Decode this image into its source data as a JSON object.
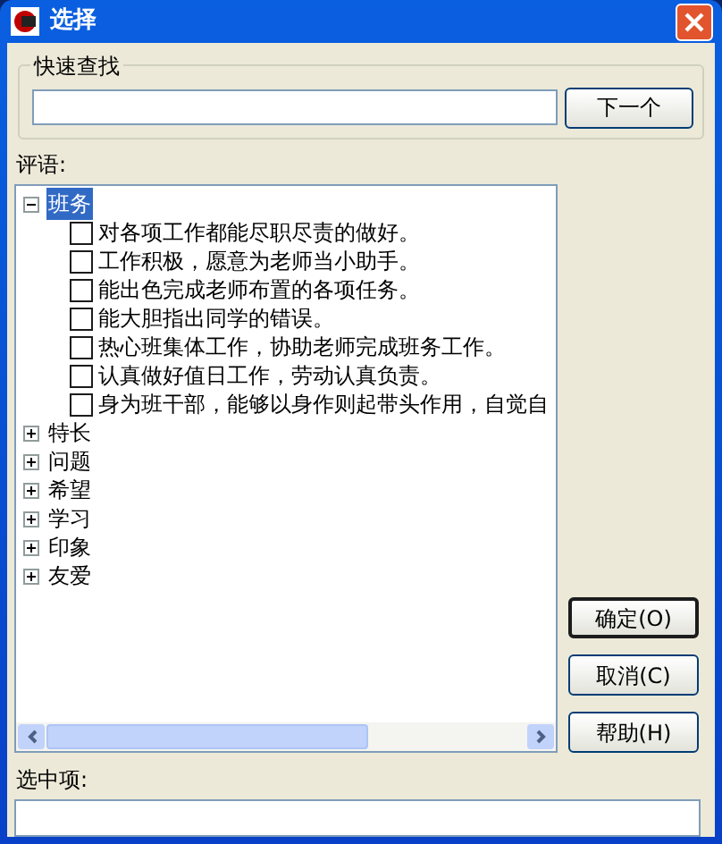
{
  "window": {
    "title": "选择"
  },
  "quick_find": {
    "legend": "快速查找",
    "button": "下一个"
  },
  "comments_label": "评语:",
  "tree": [
    {
      "label": "班务",
      "expanded": true,
      "selected": true,
      "children": [
        {
          "label": "对各项工作都能尽职尽责的做好。",
          "checked": false
        },
        {
          "label": "工作积极，愿意为老师当小助手。",
          "checked": false
        },
        {
          "label": "能出色完成老师布置的各项任务。",
          "checked": false
        },
        {
          "label": "能大胆指出同学的错误。",
          "checked": false
        },
        {
          "label": "热心班集体工作，协助老师完成班务工作。",
          "checked": false
        },
        {
          "label": "认真做好值日工作，劳动认真负责。",
          "checked": false
        },
        {
          "label": "身为班干部，能够以身作则起带头作用，自觉自",
          "checked": false
        }
      ]
    },
    {
      "label": "特长",
      "expanded": false,
      "selected": false
    },
    {
      "label": "问题",
      "expanded": false,
      "selected": false
    },
    {
      "label": "希望",
      "expanded": false,
      "selected": false
    },
    {
      "label": "学习",
      "expanded": false,
      "selected": false
    },
    {
      "label": "印象",
      "expanded": false,
      "selected": false
    },
    {
      "label": "友爱",
      "expanded": false,
      "selected": false
    }
  ],
  "buttons": [
    {
      "label": "确定(O)",
      "default": true
    },
    {
      "label": "取消(C)",
      "default": false
    },
    {
      "label": "帮助(H)",
      "default": false
    }
  ],
  "selected_label": "选中项:"
}
